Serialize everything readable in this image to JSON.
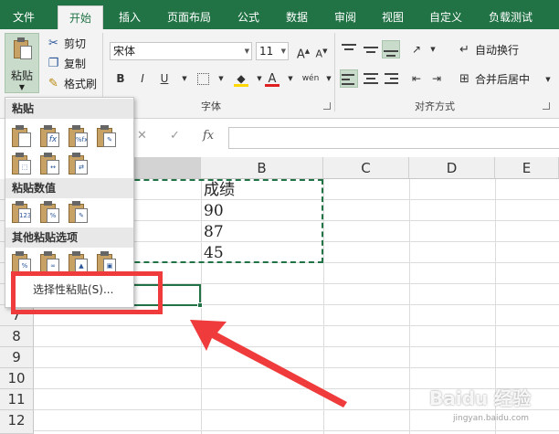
{
  "tabs": [
    "文件",
    "开始",
    "插入",
    "页面布局",
    "公式",
    "数据",
    "审阅",
    "视图",
    "自定义",
    "负载测试"
  ],
  "active_tab": "开始",
  "ribbon": {
    "clipboard": {
      "paste_label": "粘贴",
      "cut_label": "剪切",
      "copy_label": "复制",
      "format_painter_label": "格式刷"
    },
    "font": {
      "group_label": "字体",
      "font_name": "宋体",
      "font_size": "11",
      "bold": "B",
      "italic": "I",
      "underline": "U",
      "grow": "A",
      "shrink": "A",
      "wen": "wén",
      "font_color_letter": "A"
    },
    "alignment": {
      "group_label": "对齐方式",
      "wrap_text_label": "自动换行",
      "merge_center_label": "合并后居中"
    }
  },
  "formula_bar": {
    "cancel": "✕",
    "enter": "✓",
    "fx": "fx"
  },
  "columns": [
    "B",
    "C",
    "D",
    "E"
  ],
  "rows": [
    "7",
    "8",
    "9",
    "10",
    "11",
    "12"
  ],
  "cells": {
    "B1": "成绩",
    "B2": "90",
    "B3": "87",
    "B4": "45"
  },
  "paste_menu": {
    "section_paste": "粘贴",
    "section_values": "粘贴数值",
    "section_other": "其他粘贴选项",
    "paste_special": "选择性粘贴(S)..."
  },
  "icons": {
    "paste": "clipboard-icon",
    "cut": "scissors-icon",
    "copy": "copy-icon",
    "format_painter": "paintbrush-icon"
  },
  "colors": {
    "excel_green": "#217346",
    "annotation_red": "#ef3b3b",
    "font_color": "#e02020",
    "highlight": "#ffd800"
  },
  "watermark": {
    "brand": "Baidu 经验",
    "url": "jingyan.baidu.com"
  }
}
